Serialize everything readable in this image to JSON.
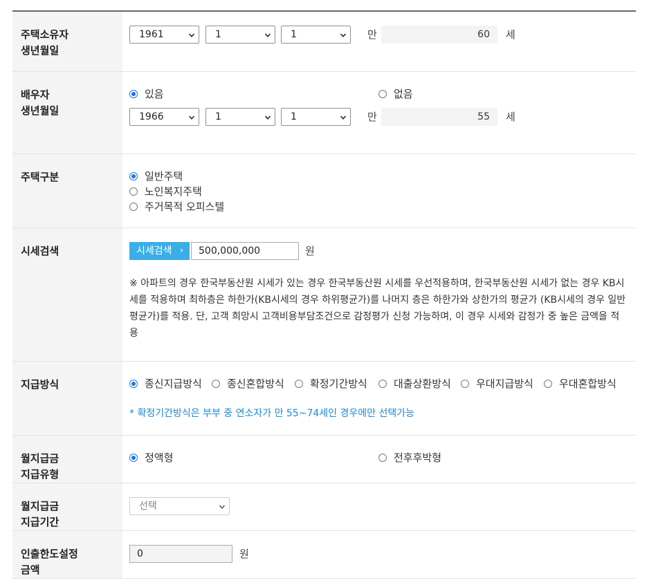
{
  "owner_birth": {
    "label": "주택소유자\n생년월일",
    "year": "1961",
    "month": "1",
    "day": "1",
    "age_prefix": "만",
    "age": "60",
    "age_suffix": "세"
  },
  "spouse_birth": {
    "label": "배우자\n생년월일",
    "radio_yes": "있음",
    "radio_no": "없음",
    "year": "1966",
    "month": "1",
    "day": "1",
    "age_prefix": "만",
    "age": "55",
    "age_suffix": "세"
  },
  "house_type": {
    "label": "주택구분",
    "options": [
      "일반주택",
      "노인복지주택",
      "주거목적 오피스텔"
    ]
  },
  "price_search": {
    "label": "시세검색",
    "button": "시세검색",
    "button_chevron": "›",
    "value": "500,000,000",
    "unit": "원",
    "notice": "※ 아파트의 경우 한국부동산원 시세가 있는 경우 한국부동산원 시세를 우선적용하며, 한국부동산원 시세가 없는 경우 KB시세를 적용하며 최하층은 하한가(KB시세의 경우 하위평균가)를 나머지 층은 하한가와 상한가의 평균가 (KB시세의 경우 일반평균가)를 적용. 단, 고객 희망시 고객비용부담조건으로 감정평가 신청 가능하며, 이 경우 시세와 감정가 중 높은 금액을 적용"
  },
  "payment_method": {
    "label": "지급방식",
    "options": [
      "종신지급방식",
      "종신혼합방식",
      "확정기간방식",
      "대출상환방식",
      "우대지급방식",
      "우대혼합방식"
    ],
    "note": "* 확정기간방식은 부부 중 연소자가 만 55~74세인 경우에만 선택가능"
  },
  "monthly_type": {
    "label": "월지급금\n지급유형",
    "option_fixed": "정액형",
    "option_front": "전후후박형"
  },
  "monthly_period": {
    "label": "월지급금\n지급기간",
    "placeholder": "선택"
  },
  "withdrawal_limit": {
    "label": "인출한도설정\n금액",
    "value": "0",
    "unit": "원"
  },
  "colors": {
    "accent": "#1a73e8",
    "button": "#3aaee8",
    "note": "#1a8ad4",
    "header_bg": "#f4f4f4"
  }
}
